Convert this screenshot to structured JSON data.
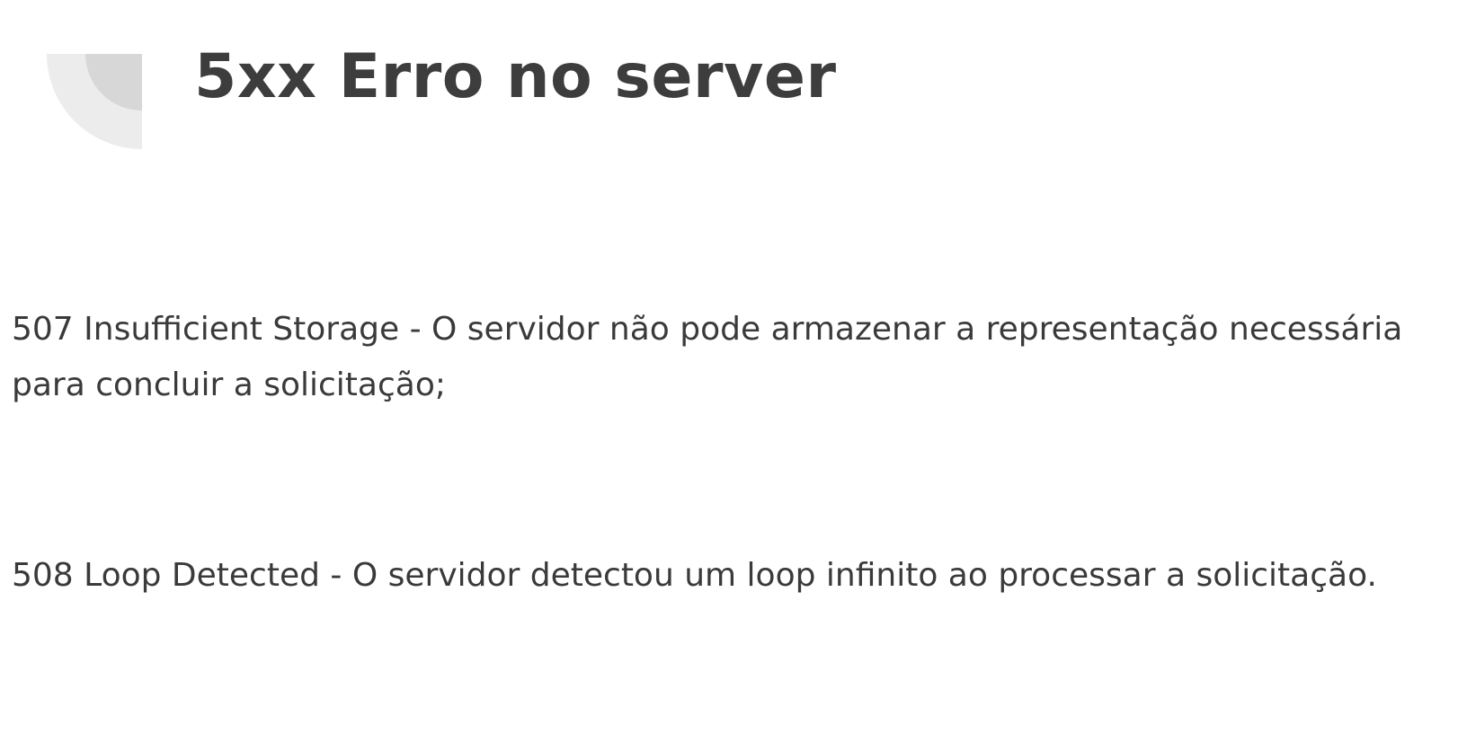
{
  "title": "5xx Erro no server",
  "decoration": {
    "name": "quarter-circle-decoration",
    "colors": [
      "#ebebeb",
      "#d6d6d6"
    ]
  },
  "items": [
    {
      "text": "507 Insufficient Storage - O servidor não pode armazenar a representação necessária para concluir a solicitação;"
    },
    {
      "text": "508 Loop Detected - O servidor detectou um loop infinito ao processar a solicitação."
    }
  ]
}
